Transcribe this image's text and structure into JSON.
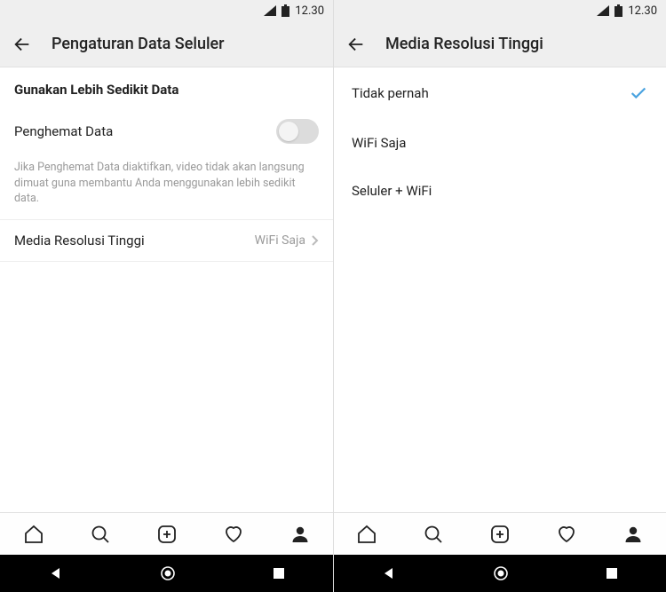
{
  "status": {
    "time": "12.30"
  },
  "left": {
    "header": {
      "title": "Pengaturan Data Seluler"
    },
    "section_title": "Gunakan Lebih Sedikit Data",
    "data_saver_label": "Penghemat Data",
    "helper_text": "Jika Penghemat Data diaktifkan, video tidak akan langsung dimuat guna membantu Anda menggunakan lebih sedikit data.",
    "high_res_label": "Media Resolusi Tinggi",
    "high_res_value": "WiFi Saja"
  },
  "right": {
    "header": {
      "title": "Media Resolusi Tinggi"
    },
    "options": {
      "never": "Tidak pernah",
      "wifi": "WiFi Saja",
      "both": "Seluler + WiFi"
    }
  }
}
